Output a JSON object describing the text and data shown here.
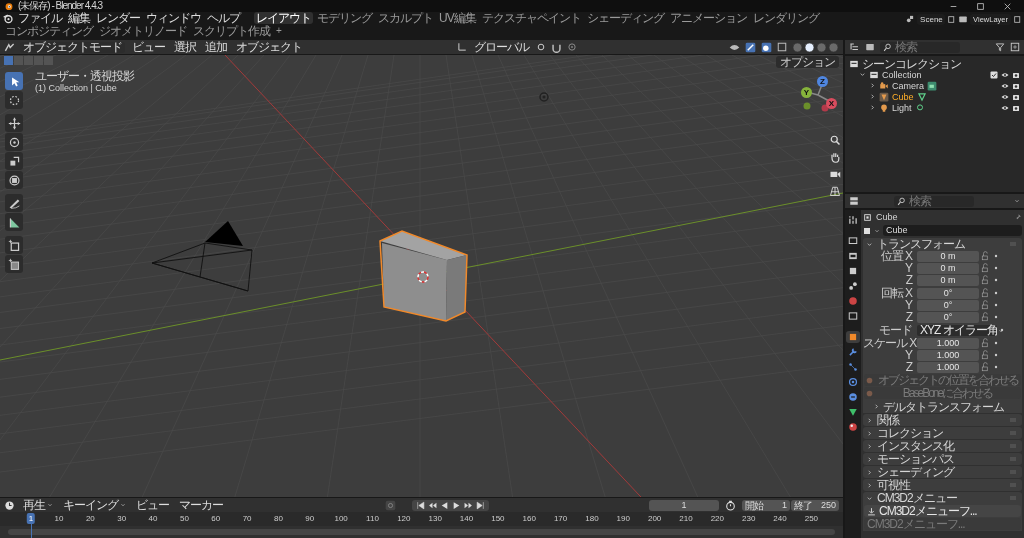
{
  "window": {
    "title": "(未保存) - Blender 4.4.3"
  },
  "menu": [
    "ファイル",
    "編集",
    "レンダー",
    "ウィンドウ",
    "ヘルプ"
  ],
  "workspaces": [
    {
      "label": "レイアウト",
      "selected": true
    },
    {
      "label": "モデリング",
      "selected": false
    },
    {
      "label": "スカルプト",
      "selected": false
    },
    {
      "label": "UV編集",
      "selected": false
    },
    {
      "label": "テクスチャペイント",
      "selected": false
    },
    {
      "label": "シェーディング",
      "selected": false
    },
    {
      "label": "アニメーション",
      "selected": false
    },
    {
      "label": "レンダリング",
      "selected": false
    },
    {
      "label": "コンポジティング",
      "selected": false
    },
    {
      "label": "ジオメトリノード",
      "selected": false
    },
    {
      "label": "スクリプト作成",
      "selected": false
    }
  ],
  "add_workspace": "+",
  "scene": "Scene",
  "view_layer": "ViewLayer",
  "viewport": {
    "mode": "オブジェクトモード",
    "menus": [
      "ビュー",
      "選択",
      "追加",
      "オブジェクト"
    ],
    "orientation": "グローバル",
    "options": "オプション",
    "view_label": "ユーザー・透視投影",
    "object_label": "(1) Collection | Cube",
    "select_modes": [
      {
        "selected": true
      },
      {
        "selected": false
      },
      {
        "selected": false
      },
      {
        "selected": false
      },
      {
        "selected": false
      }
    ],
    "shading": [
      {
        "selected": false
      },
      {
        "selected": true
      },
      {
        "selected": false
      },
      {
        "selected": false
      }
    ],
    "tools": [
      {
        "kind": "select",
        "selected": true
      },
      {
        "kind": "cursor",
        "selected": false
      },
      {
        "kind": "move",
        "selected": false
      },
      {
        "kind": "rotate",
        "selected": false
      },
      {
        "kind": "scale",
        "selected": false
      },
      {
        "kind": "transform",
        "selected": false
      },
      {
        "kind": "annotate",
        "selected": false
      },
      {
        "kind": "measure",
        "selected": false
      },
      {
        "kind": "add-cube",
        "selected": false
      },
      {
        "kind": "add-object",
        "selected": false
      }
    ],
    "axes": [
      "X",
      "Y",
      "Z"
    ]
  },
  "outliner": {
    "search_placeholder": "検索",
    "root": "シーンコレクション",
    "items": [
      {
        "label": "Collection",
        "kind": "collection",
        "checked": true,
        "selected": false,
        "expanded": true,
        "children": [
          {
            "label": "Camera",
            "kind": "camera",
            "selected": false,
            "expanded": false
          },
          {
            "label": "Cube",
            "kind": "mesh",
            "selected": true,
            "expanded": false
          },
          {
            "label": "Light",
            "kind": "light",
            "selected": false,
            "expanded": false
          }
        ]
      }
    ]
  },
  "properties": {
    "search_placeholder": "検索",
    "tabs": [
      {
        "kind": "tool",
        "selected": false
      },
      {
        "kind": "render",
        "selected": false
      },
      {
        "kind": "output",
        "selected": false
      },
      {
        "kind": "view-layer",
        "selected": false
      },
      {
        "kind": "scene",
        "selected": false
      },
      {
        "kind": "world",
        "selected": false
      },
      {
        "kind": "collection",
        "selected": false
      },
      {
        "kind": "object",
        "selected": true
      },
      {
        "kind": "modifier",
        "selected": false
      },
      {
        "kind": "particles",
        "selected": false
      },
      {
        "kind": "physics",
        "selected": false
      },
      {
        "kind": "constraints",
        "selected": false
      },
      {
        "kind": "data",
        "selected": false
      },
      {
        "kind": "material",
        "selected": false
      }
    ],
    "object_name": "Cube",
    "data_name": "Cube",
    "transform": {
      "title": "トランスフォーム",
      "expanded": true,
      "groups": [
        {
          "rows": [
            {
              "label": "位置 X",
              "value": "0 m",
              "kind": "field"
            },
            {
              "label": "Y",
              "value": "0 m",
              "kind": "field"
            },
            {
              "label": "Z",
              "value": "0 m",
              "kind": "field"
            }
          ]
        },
        {
          "rows": [
            {
              "label": "回転 X",
              "value": "0°",
              "kind": "field"
            },
            {
              "label": "Y",
              "value": "0°",
              "kind": "field"
            },
            {
              "label": "Z",
              "value": "0°",
              "kind": "field"
            }
          ]
        },
        {
          "rows": [
            {
              "label": "モード",
              "value": "XYZ オイラー角",
              "kind": "dropdown"
            }
          ]
        },
        {
          "rows": [
            {
              "label": "スケール X",
              "value": "1.000",
              "kind": "field"
            },
            {
              "label": "Y",
              "value": "1.000",
              "kind": "field"
            },
            {
              "label": "Z",
              "value": "1.000",
              "kind": "field"
            }
          ]
        }
      ],
      "buttons": [
        {
          "label": "オブジェクトの位置を合わせる",
          "disabled": true
        },
        {
          "label": "BaseBoneに合わせる",
          "disabled": true
        }
      ],
      "subpanels": [
        {
          "title": "デルタトランスフォーム",
          "expanded": false
        }
      ]
    },
    "panels": [
      {
        "title": "関係",
        "expanded": false
      },
      {
        "title": "コレクション",
        "expanded": false
      },
      {
        "title": "インスタンス化",
        "expanded": false
      },
      {
        "title": "モーションパス",
        "expanded": false
      },
      {
        "title": "シェーディング",
        "expanded": false
      },
      {
        "title": "可視性",
        "expanded": false
      },
      {
        "title": "CM3D2メニュー",
        "expanded": true,
        "buttons": [
          {
            "label": "CM3D2メニューフ...",
            "disabled": false
          },
          {
            "label": "CM3D2メニューフ...",
            "disabled": true
          }
        ]
      }
    ]
  },
  "timeline": {
    "menus": [
      {
        "label": "再生",
        "dropdown": true
      },
      {
        "label": "キーイング",
        "dropdown": true
      },
      {
        "label": "ビュー",
        "dropdown": false
      },
      {
        "label": "マーカー",
        "dropdown": false
      }
    ],
    "current_frame": "1",
    "start_label": "開始",
    "start": "1",
    "end_label": "終了",
    "end": "250",
    "ticks": [
      {
        "label": "1",
        "selected": true
      },
      {
        "label": "10",
        "selected": false
      },
      {
        "label": "20",
        "selected": false
      },
      {
        "label": "30",
        "selected": false
      },
      {
        "label": "40",
        "selected": false
      },
      {
        "label": "50",
        "selected": false
      },
      {
        "label": "60",
        "selected": false
      },
      {
        "label": "70",
        "selected": false
      },
      {
        "label": "80",
        "selected": false
      },
      {
        "label": "90",
        "selected": false
      },
      {
        "label": "100",
        "selected": false
      },
      {
        "label": "110",
        "selected": false
      },
      {
        "label": "120",
        "selected": false
      },
      {
        "label": "130",
        "selected": false
      },
      {
        "label": "140",
        "selected": false
      },
      {
        "label": "150",
        "selected": false
      },
      {
        "label": "160",
        "selected": false
      },
      {
        "label": "170",
        "selected": false
      },
      {
        "label": "180",
        "selected": false
      },
      {
        "label": "190",
        "selected": false
      },
      {
        "label": "200",
        "selected": false
      },
      {
        "label": "210",
        "selected": false
      },
      {
        "label": "220",
        "selected": false
      },
      {
        "label": "230",
        "selected": false
      },
      {
        "label": "240",
        "selected": false
      },
      {
        "label": "250",
        "selected": false
      }
    ]
  }
}
